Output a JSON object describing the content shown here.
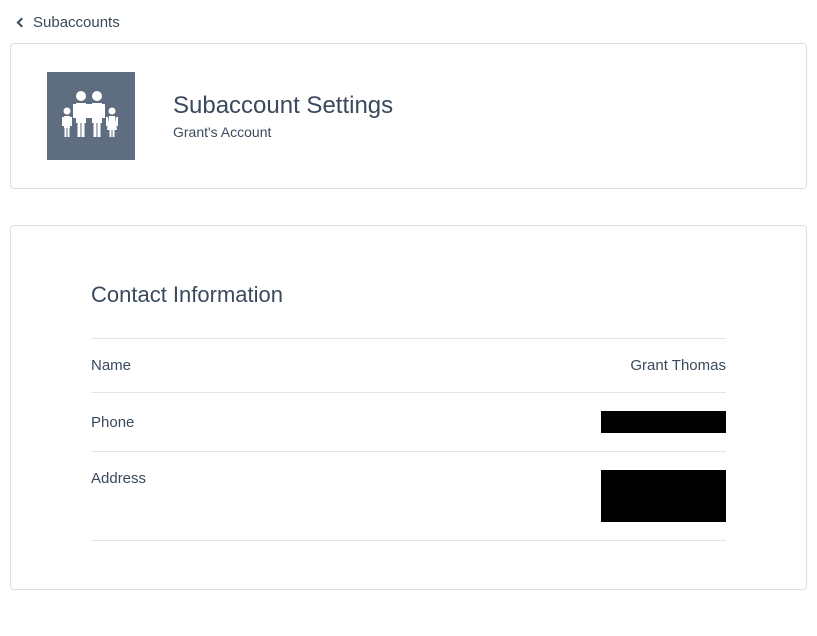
{
  "breadcrumb": {
    "label": "Subaccounts"
  },
  "header": {
    "title": "Subaccount Settings",
    "subtitle": "Grant's Account"
  },
  "contact": {
    "section_title": "Contact Information",
    "rows": {
      "name": {
        "label": "Name",
        "value": "Grant Thomas"
      },
      "phone": {
        "label": "Phone"
      },
      "address": {
        "label": "Address"
      }
    }
  }
}
